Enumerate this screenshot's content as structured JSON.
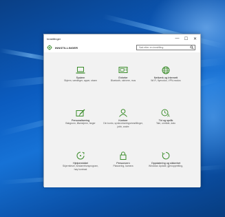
{
  "window": {
    "title": "Innstillinger",
    "controls": {
      "minimize": "—",
      "maximize": "☐",
      "close": "✕"
    }
  },
  "header": {
    "app_title": "INNSTILLINGER",
    "search_placeholder": "Søk etter en innstilling"
  },
  "tiles": [
    {
      "title": "System",
      "desc": "Skjerm, varslinger, apper, strøm",
      "icon": "laptop-icon"
    },
    {
      "title": "Enheter",
      "desc": "Bluetooth, skrivere, mus",
      "icon": "devices-icon"
    },
    {
      "title": "Nettverk og Internett",
      "desc": "Wi-Fi, flymodus, VPN-modus",
      "icon": "globe-icon"
    },
    {
      "title": "Personalisering",
      "desc": "Bakgrunn, låseskjerm, farger",
      "icon": "paint-icon"
    },
    {
      "title": "Kontoer",
      "desc": "Din konto, synkroniseringsinnstillinger, jobb, andre",
      "icon": "person-icon"
    },
    {
      "title": "Tid og språk",
      "desc": "Tale, område, dato",
      "icon": "time-language-icon"
    },
    {
      "title": "Hjelpemiddel",
      "desc": "Skjermleser, forstørrelsesprogram, høy kontrast",
      "icon": "accessibility-icon"
    },
    {
      "title": "Personvern",
      "desc": "Plassering, kamera",
      "icon": "lock-icon"
    },
    {
      "title": "Oppdatering og sikkerhet",
      "desc": "Windows Update, gjenoppretting,",
      "icon": "update-icon"
    }
  ],
  "colors": {
    "accent": "#3a8c2a",
    "desktop_blue": "#0b5cc0",
    "content_bg": "#f2f2f2"
  }
}
